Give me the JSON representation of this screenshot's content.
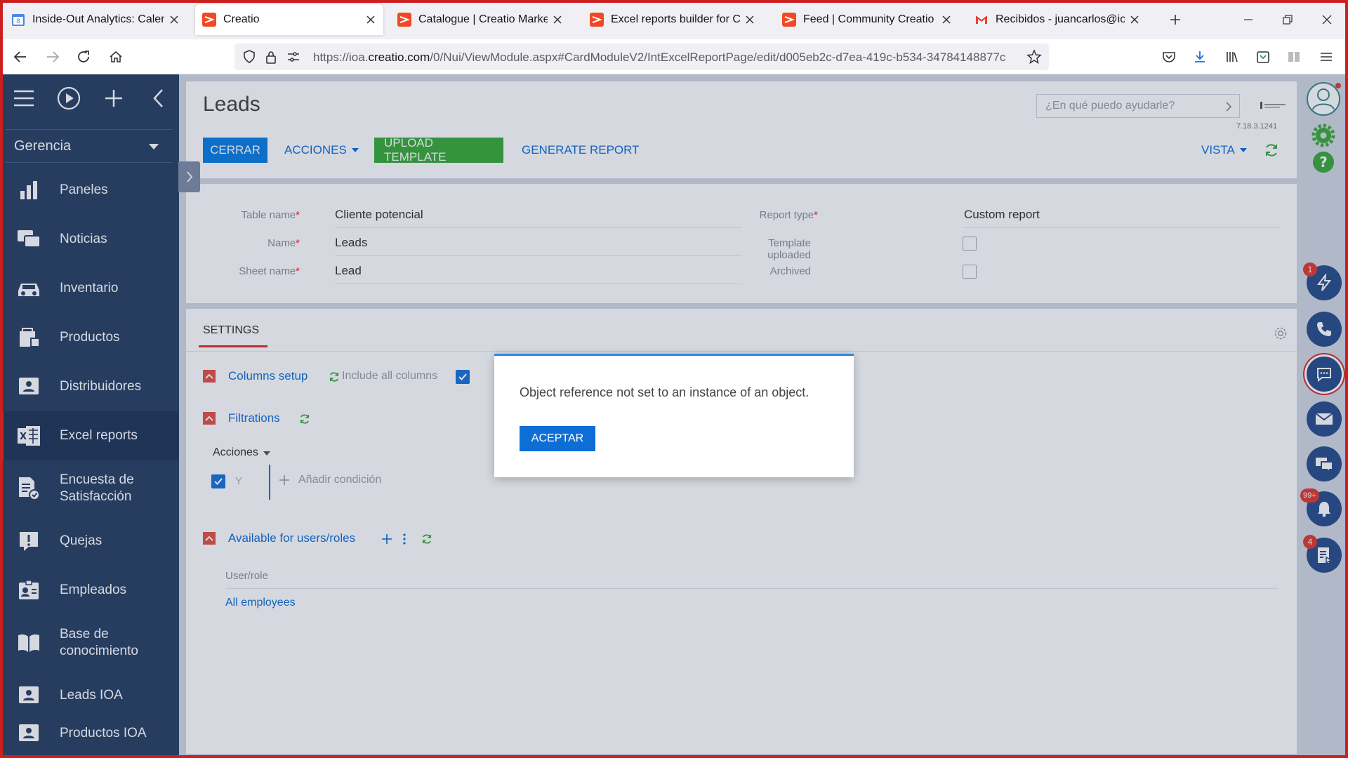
{
  "browser": {
    "tabs": [
      {
        "title": "Inside-Out Analytics: Calendario",
        "favicon": "calendar-favicon"
      },
      {
        "title": "Creatio",
        "favicon": "creatio-favicon"
      },
      {
        "title": "Catalogue | Creatio Marketplace",
        "favicon": "creatio-favicon"
      },
      {
        "title": "Excel reports builder for Creatio",
        "favicon": "creatio-favicon"
      },
      {
        "title": "Feed | Community Creatio",
        "favicon": "creatio-favicon"
      },
      {
        "title": "Recibidos - juancarlos@ioa.mx",
        "favicon": "gmail-favicon"
      }
    ],
    "url_prefix": "https://ioa.",
    "url_domain": "creatio.com",
    "url_rest": "/0/Nui/ViewModule.aspx#CardModuleV2/IntExcelReportPage/edit/d005eb2c-d7ea-419c-b534-34784148877c"
  },
  "sidebar": {
    "workspace": "Gerencia",
    "items": [
      {
        "label": "Paneles",
        "icon": "chart-icon"
      },
      {
        "label": "Noticias",
        "icon": "news-icon"
      },
      {
        "label": "Inventario",
        "icon": "car-icon"
      },
      {
        "label": "Productos",
        "icon": "products-icon"
      },
      {
        "label": "Distribuidores",
        "icon": "contact-card-icon"
      },
      {
        "label": "Excel reports",
        "icon": "excel-icon"
      },
      {
        "label": "Encuesta de Satisfacción",
        "icon": "survey-icon"
      },
      {
        "label": "Quejas",
        "icon": "alert-icon"
      },
      {
        "label": "Empleados",
        "icon": "badge-icon"
      },
      {
        "label": "Base de conocimiento",
        "icon": "book-icon"
      },
      {
        "label": "Leads IOA",
        "icon": "contact-card-icon"
      },
      {
        "label": "Productos IOA",
        "icon": "contact-card-icon"
      }
    ]
  },
  "header": {
    "title": "Leads",
    "buttons": {
      "close": "CERRAR",
      "actions": "ACCIONES",
      "upload": "UPLOAD TEMPLATE",
      "generate": "GENERATE REPORT",
      "view": "VISTA"
    },
    "help_placeholder": "¿En qué puedo ayudarle?",
    "version": "7.18.3.1241"
  },
  "fields": {
    "table_name": {
      "label": "Table name",
      "value": "Cliente potencial"
    },
    "name": {
      "label": "Name",
      "value": "Leads"
    },
    "sheet_name": {
      "label": "Sheet name",
      "value": "Lead"
    },
    "report_type": {
      "label": "Report type",
      "value": "Custom report"
    },
    "template_uploaded": {
      "label": "Template uploaded",
      "checked": false
    },
    "archived": {
      "label": "Archived",
      "checked": false
    },
    "required_mark": "*"
  },
  "settings": {
    "tab": "SETTINGS",
    "columns_setup": "Columns setup",
    "include_all_columns": "Include all columns",
    "filtrations": "Filtrations",
    "actions_menu": "Acciones",
    "logic_op": "Y",
    "add_condition": "Añadir condición",
    "available_for": "Available for users/roles",
    "user_role_header": "User/role",
    "user_role_rows": [
      "All employees"
    ]
  },
  "dialog": {
    "message": "Object reference not set to an instance of an object.",
    "ok": "ACEPTAR"
  },
  "rail": {
    "badges": {
      "actions": "1",
      "notifications": "99+",
      "tasks": "4"
    }
  },
  "colors": {
    "sidebar": "#2b4264",
    "primary": "#0d7fe3",
    "success": "#3caa3a",
    "danger": "#e45247",
    "link": "#1371d6"
  }
}
